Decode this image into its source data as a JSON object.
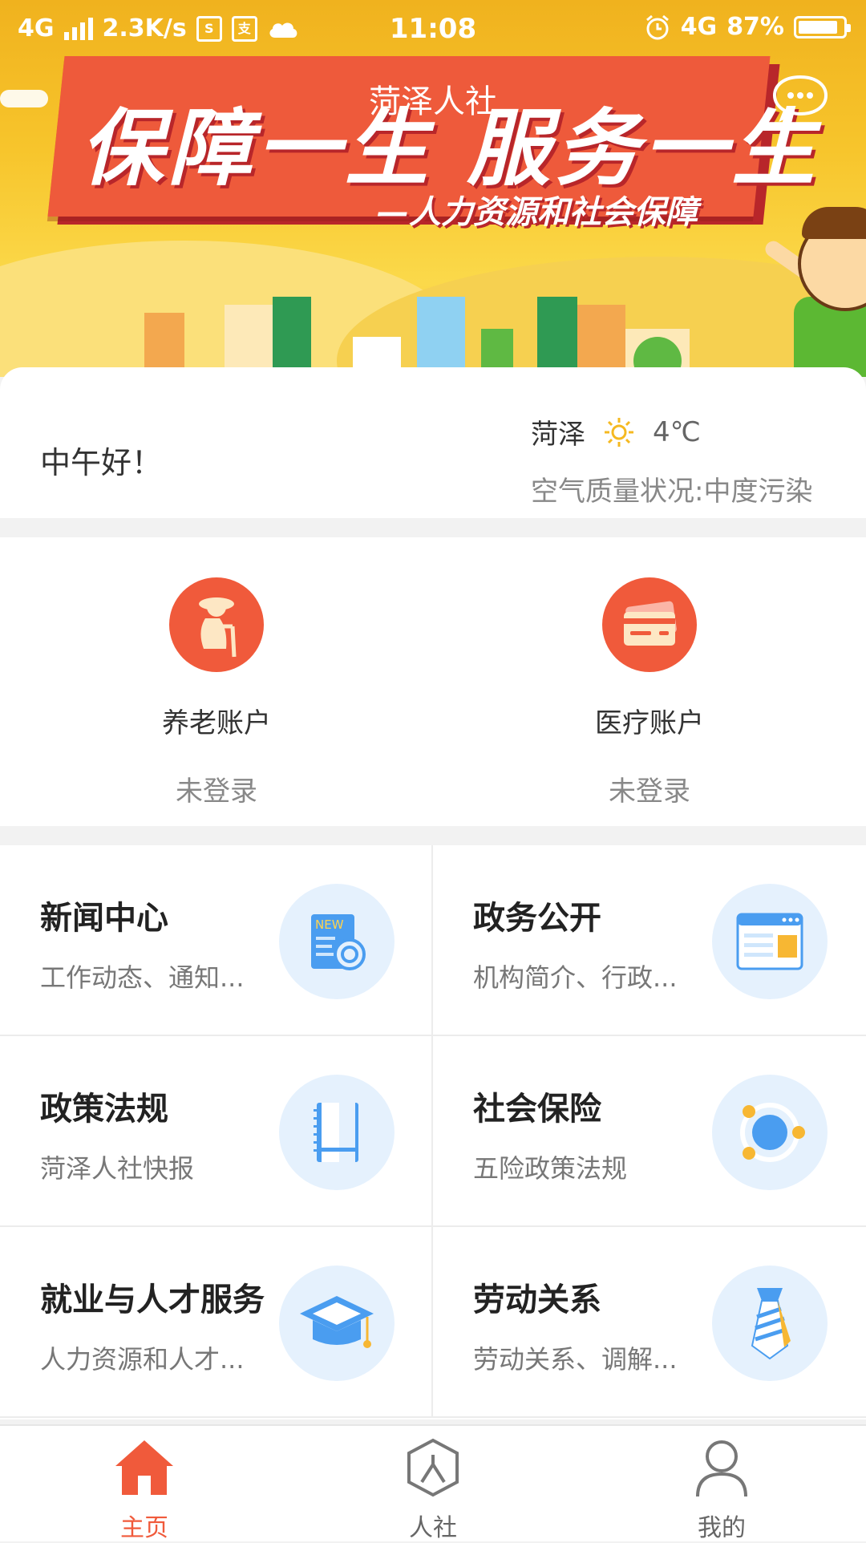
{
  "status_bar": {
    "network": "4G",
    "speed": "2.3K/s",
    "icon_s": "S",
    "time": "11:08",
    "network_right": "4G",
    "battery": "87%"
  },
  "banner": {
    "app_title": "菏泽人社",
    "slogan": "保障一生 服务一生",
    "slogan_sub": "—人力资源和社会保障"
  },
  "greeting": {
    "text": "中午好！",
    "city": "菏泽",
    "temperature": "4℃",
    "air_quality": "空气质量状况:中度污染"
  },
  "accounts": [
    {
      "label": "养老账户",
      "status": "未登录",
      "icon": "elderly-icon"
    },
    {
      "label": "医疗账户",
      "status": "未登录",
      "icon": "card-icon"
    }
  ],
  "services": [
    {
      "title": "新闻中心",
      "subtitle": "工作动态、通知...",
      "icon": "news-icon"
    },
    {
      "title": "政务公开",
      "subtitle": "机构简介、行政...",
      "icon": "browser-window-icon"
    },
    {
      "title": "政策法规",
      "subtitle": "菏泽人社快报",
      "icon": "notebook-icon"
    },
    {
      "title": "社会保险",
      "subtitle": "五险政策法规",
      "icon": "orbit-icon"
    },
    {
      "title": "就业与人才服务",
      "subtitle": "人力资源和人才...",
      "icon": "graduation-cap-icon"
    },
    {
      "title": "劳动关系",
      "subtitle": "劳动关系、调解...",
      "icon": "tie-icon"
    }
  ],
  "tabs": [
    {
      "label": "主页",
      "icon": "home-icon",
      "active": true
    },
    {
      "label": "人社",
      "icon": "hexagon-person-icon",
      "active": false
    },
    {
      "label": "我的",
      "icon": "user-icon",
      "active": false
    }
  ],
  "colors": {
    "accent": "#f05a3b",
    "banner_yellow": "#f7c52c",
    "icon_bg": "#e5f1fd",
    "icon_blue": "#4a9df0"
  }
}
